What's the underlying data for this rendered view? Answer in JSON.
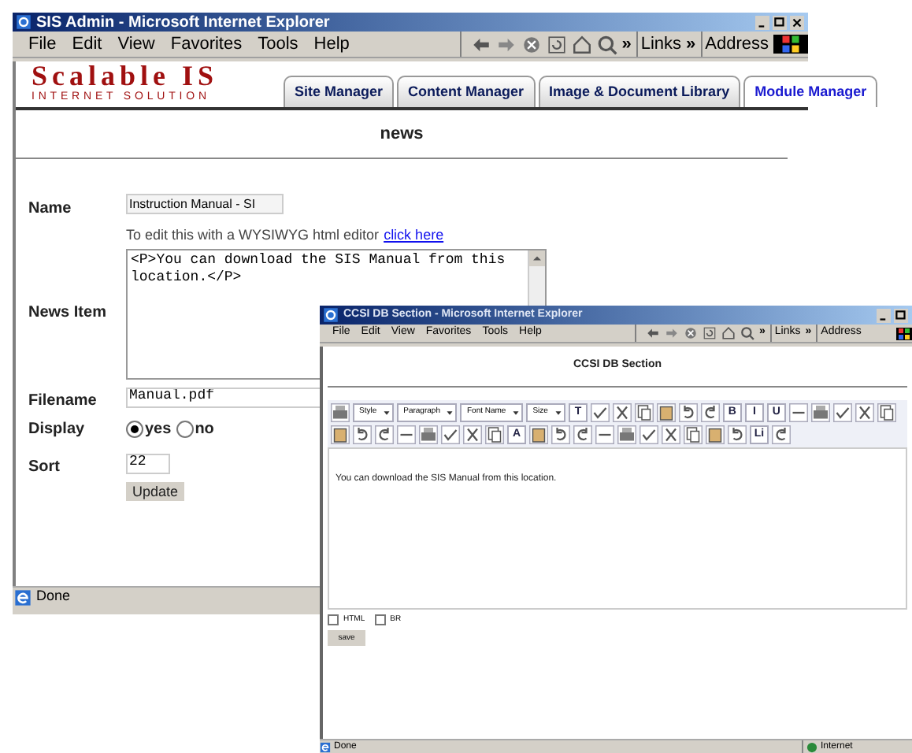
{
  "main_window": {
    "title": "SIS Admin - Microsoft Internet Explorer",
    "menu": [
      "File",
      "Edit",
      "View",
      "Favorites",
      "Tools",
      "Help"
    ],
    "toolbar": {
      "chevron": "»",
      "links": "Links",
      "links_chevron": "»",
      "address": "Address"
    },
    "logo": {
      "title": "Scalable IS",
      "subtitle": "INTERNET SOLUTION"
    },
    "tabs": [
      {
        "label": "Site Manager",
        "selected": false
      },
      {
        "label": "Content Manager",
        "selected": false
      },
      {
        "label": "Image & Document Library",
        "selected": false
      },
      {
        "label": "Module Manager",
        "selected": true
      }
    ],
    "heading": "news",
    "form": {
      "name_label": "Name",
      "name_value": "Instruction Manual - SI",
      "editor_hint": "To edit this with a WYSIWYG html editor",
      "editor_link": "click here",
      "news_label": "News Item",
      "news_value": "<P>You can download the SIS Manual from this location.</P>",
      "filename_label": "Filename",
      "filename_value": "Manual.pdf",
      "display_label": "Display",
      "display_options": [
        {
          "label": "yes",
          "selected": true
        },
        {
          "label": "no",
          "selected": false
        }
      ],
      "sort_label": "Sort",
      "sort_value": "22",
      "button": "Update"
    },
    "status": "Done"
  },
  "popup_window": {
    "title": "CCSI DB Section - Microsoft Internet Explorer",
    "menu": [
      "File",
      "Edit",
      "View",
      "Favorites",
      "Tools",
      "Help"
    ],
    "toolbar": {
      "chevron": "»",
      "links": "Links",
      "links_chevron": "»",
      "address": "Address"
    },
    "heading": "CCSI DB Section",
    "editor_toolbar": [
      [
        {
          "kind": "icon"
        },
        {
          "kind": "dropdown",
          "label": "Style"
        },
        {
          "kind": "dropdown",
          "label": "Paragraph"
        },
        {
          "kind": "dropdown",
          "label": "Font Name"
        },
        {
          "kind": "dropdown",
          "label": "Size"
        },
        {
          "kind": "glyph",
          "label": "T"
        },
        {
          "kind": "icon"
        },
        {
          "kind": "icon"
        },
        {
          "kind": "icon"
        },
        {
          "kind": "icon"
        },
        {
          "kind": "icon"
        },
        {
          "kind": "icon"
        },
        {
          "kind": "glyph",
          "label": "B"
        },
        {
          "kind": "glyph",
          "label": "I"
        },
        {
          "kind": "glyph",
          "label": "U"
        },
        {
          "kind": "icon"
        },
        {
          "kind": "icon"
        },
        {
          "kind": "icon"
        },
        {
          "kind": "icon"
        },
        {
          "kind": "icon"
        }
      ],
      [
        {
          "kind": "icon"
        },
        {
          "kind": "icon"
        },
        {
          "kind": "icon"
        },
        {
          "kind": "icon"
        },
        {
          "kind": "icon"
        },
        {
          "kind": "icon"
        },
        {
          "kind": "icon"
        },
        {
          "kind": "icon"
        },
        {
          "kind": "glyph",
          "label": "A"
        },
        {
          "kind": "icon"
        },
        {
          "kind": "icon"
        },
        {
          "kind": "icon"
        },
        {
          "kind": "icon"
        },
        {
          "kind": "icon"
        },
        {
          "kind": "icon"
        },
        {
          "kind": "icon"
        },
        {
          "kind": "icon"
        },
        {
          "kind": "icon"
        },
        {
          "kind": "icon"
        },
        {
          "kind": "glyph",
          "label": "Li"
        },
        {
          "kind": "icon"
        }
      ]
    ],
    "editor_text": "You can download the SIS Manual from this location.",
    "options": [
      {
        "label": "HTML",
        "checked": false
      },
      {
        "label": "BR",
        "checked": false
      }
    ],
    "button": "save",
    "status": "Done",
    "zone": "Internet"
  }
}
